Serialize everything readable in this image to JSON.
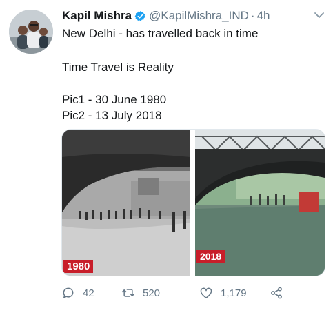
{
  "tweet": {
    "author_name": "Kapil Mishra",
    "handle": "@KapilMishra_IND",
    "separator": "·",
    "time": "4h",
    "lines": [
      "New Delhi - has travelled back in time",
      "Time Travel is Reality",
      "Pic1 - 30 June 1980",
      "Pic2 - 13 July 2018"
    ],
    "media": {
      "photo1_label": "1980",
      "photo2_label": "2018"
    },
    "actions": {
      "replies": "42",
      "retweets": "520",
      "likes": "1,179"
    }
  },
  "icons": {
    "verified": "verified-badge-icon",
    "menu": "chevron-down-icon",
    "reply": "reply-icon",
    "retweet": "retweet-icon",
    "like": "heart-icon",
    "share": "share-icon"
  },
  "colors": {
    "verified": "#1da1f2",
    "year_tag": "#c81e2a",
    "secondary_text": "#657786"
  }
}
